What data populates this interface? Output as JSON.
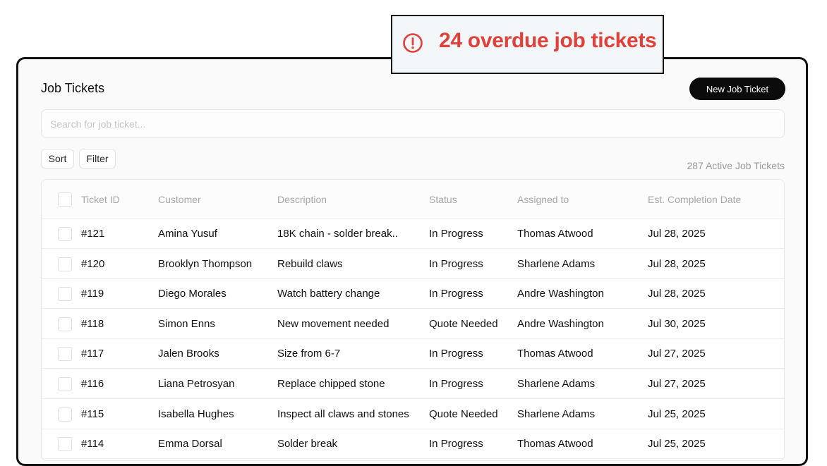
{
  "alert": {
    "icon": "alert-circle-icon",
    "text": "24 overdue job tickets",
    "color": "#e0413b"
  },
  "header": {
    "title": "Job Tickets",
    "new_button": "New Job Ticket"
  },
  "search": {
    "placeholder": "Search for job ticket..."
  },
  "controls": {
    "sort": "Sort",
    "filter": "Filter",
    "active_count": "287 Active Job Tickets"
  },
  "table": {
    "columns": [
      "Ticket ID",
      "Customer",
      "Description",
      "Status",
      "Assigned to",
      "Est. Completion Date"
    ],
    "rows": [
      {
        "id": "#121",
        "customer": "Amina Yusuf",
        "description": "18K chain - solder break..",
        "status": "In Progress",
        "assigned": "Thomas Atwood",
        "date": "Jul 28, 2025"
      },
      {
        "id": "#120",
        "customer": "Brooklyn Thompson",
        "description": "Rebuild claws",
        "status": "In Progress",
        "assigned": "Sharlene Adams",
        "date": "Jul 28, 2025"
      },
      {
        "id": "#119",
        "customer": "Diego Morales",
        "description": "Watch battery change",
        "status": "In Progress",
        "assigned": "Andre Washington",
        "date": "Jul 28, 2025"
      },
      {
        "id": "#118",
        "customer": "Simon Enns",
        "description": "New movement needed",
        "status": "Quote Needed",
        "assigned": "Andre Washington",
        "date": "Jul 30, 2025"
      },
      {
        "id": "#117",
        "customer": "Jalen Brooks",
        "description": "Size from 6-7",
        "status": "In Progress",
        "assigned": "Thomas Atwood",
        "date": "Jul 27, 2025"
      },
      {
        "id": "#116",
        "customer": "Liana Petrosyan",
        "description": "Replace chipped stone",
        "status": "In Progress",
        "assigned": "Sharlene Adams",
        "date": "Jul 27, 2025"
      },
      {
        "id": "#115",
        "customer": "Isabella Hughes",
        "description": "Inspect all claws and stones",
        "status": "Quote Needed",
        "assigned": "Sharlene Adams",
        "date": "Jul 25, 2025"
      },
      {
        "id": "#114",
        "customer": "Emma Dorsal",
        "description": "Solder break",
        "status": "In Progress",
        "assigned": "Thomas Atwood",
        "date": "Jul 25, 2025"
      }
    ]
  }
}
